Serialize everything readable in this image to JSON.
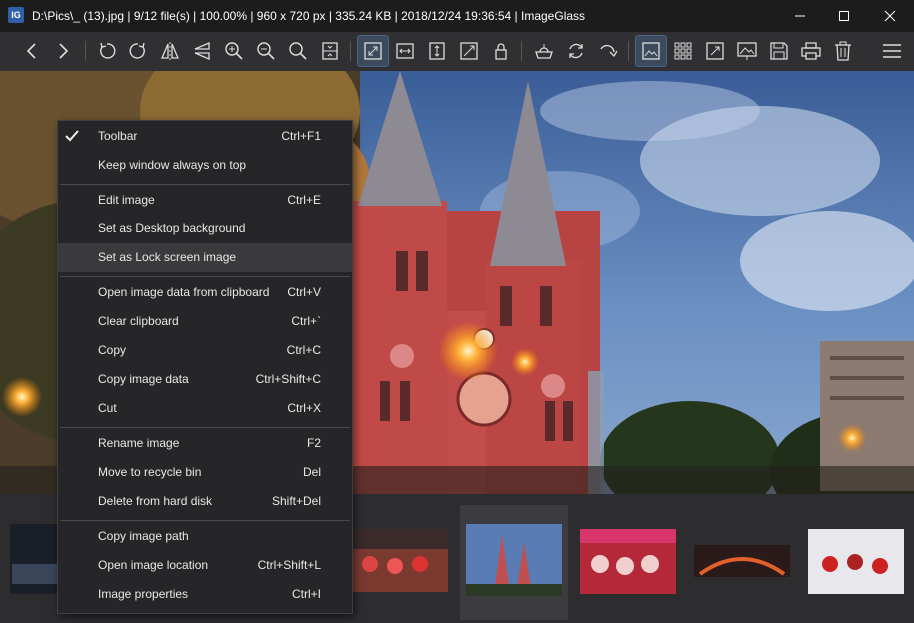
{
  "window": {
    "title": "D:\\Pics\\_ (13).jpg  |  9/12 file(s)  |  100.00%  |  960 x 720 px  |  335.24 KB  |  2018/12/24 19:36:54  |  ImageGlass",
    "app_icon_text": "IG"
  },
  "toolbar": {
    "buttons": [
      {
        "name": "back-icon"
      },
      {
        "name": "forward-icon"
      },
      {
        "name": "rotate-left-icon"
      },
      {
        "name": "rotate-right-icon"
      },
      {
        "name": "flip-horizontal-icon"
      },
      {
        "name": "flip-vertical-icon"
      },
      {
        "name": "zoom-in-icon"
      },
      {
        "name": "zoom-out-icon"
      },
      {
        "name": "zoom-to-fit-icon"
      },
      {
        "name": "scale-100-icon"
      },
      {
        "name": "auto-zoom-icon"
      },
      {
        "name": "scale-to-width-icon"
      },
      {
        "name": "scale-to-height-icon"
      },
      {
        "name": "scale-to-fill-icon"
      },
      {
        "name": "lock-zoom-icon"
      },
      {
        "name": "open-with-icon"
      },
      {
        "name": "refresh-icon"
      },
      {
        "name": "goto-icon"
      },
      {
        "name": "thumbnail-bar-icon"
      },
      {
        "name": "checkerboard-icon"
      },
      {
        "name": "fullscreen-icon"
      },
      {
        "name": "slideshow-icon"
      },
      {
        "name": "save-icon"
      },
      {
        "name": "print-icon"
      },
      {
        "name": "delete-icon"
      },
      {
        "name": "main-menu-icon"
      }
    ]
  },
  "menu": {
    "items": [
      {
        "label": "Toolbar",
        "shortcut": "Ctrl+F1",
        "checked": true
      },
      {
        "label": "Keep window always on top",
        "shortcut": ""
      },
      {
        "label": "Edit image",
        "shortcut": "Ctrl+E"
      },
      {
        "label": "Set as Desktop background",
        "shortcut": ""
      },
      {
        "label": "Set as Lock screen image",
        "shortcut": ""
      },
      {
        "label": "Open image data from clipboard",
        "shortcut": "Ctrl+V"
      },
      {
        "label": "Clear clipboard",
        "shortcut": "Ctrl+`"
      },
      {
        "label": "Copy",
        "shortcut": "Ctrl+C"
      },
      {
        "label": "Copy image data",
        "shortcut": "Ctrl+Shift+C"
      },
      {
        "label": "Cut",
        "shortcut": "Ctrl+X"
      },
      {
        "label": "Rename image",
        "shortcut": "F2"
      },
      {
        "label": "Move to recycle bin",
        "shortcut": "Del"
      },
      {
        "label": "Delete from hard disk",
        "shortcut": "Shift+Del"
      },
      {
        "label": "Copy image path",
        "shortcut": ""
      },
      {
        "label": "Open image location",
        "shortcut": "Ctrl+Shift+L"
      },
      {
        "label": "Image properties",
        "shortcut": "Ctrl+I"
      }
    ],
    "hovered_index": 4
  },
  "colors": {
    "accent": "#4a6485",
    "toolbar_bg": "#303033",
    "menu_bg": "#262628"
  }
}
